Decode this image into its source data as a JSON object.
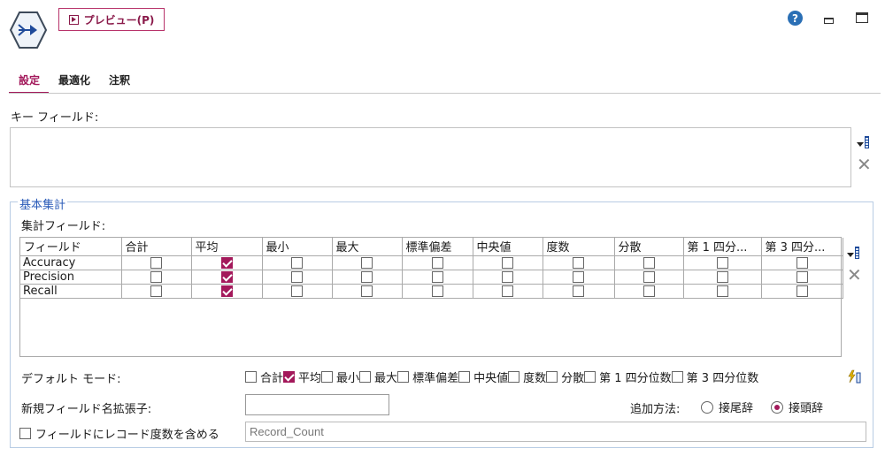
{
  "header": {
    "preview_label": "プレビュー(P)",
    "help_icon_text": "?"
  },
  "tabs": [
    {
      "label": "設定",
      "active": true
    },
    {
      "label": "最適化",
      "active": false
    },
    {
      "label": "注釈",
      "active": false
    }
  ],
  "key_fields": {
    "label": "キー フィールド:"
  },
  "basic_agg": {
    "legend": "基本集計",
    "agg_fields_label": "集計フィールド:",
    "columns": [
      "フィールド",
      "合計",
      "平均",
      "最小",
      "最大",
      "標準偏差",
      "中央値",
      "度数",
      "分散",
      "第 1 四分...",
      "第 3 四分..."
    ],
    "rows": [
      {
        "field": "Accuracy",
        "checks": [
          false,
          true,
          false,
          false,
          false,
          false,
          false,
          false,
          false,
          false
        ]
      },
      {
        "field": "Precision",
        "checks": [
          false,
          true,
          false,
          false,
          false,
          false,
          false,
          false,
          false,
          false
        ]
      },
      {
        "field": "Recall",
        "checks": [
          false,
          true,
          false,
          false,
          false,
          false,
          false,
          false,
          false,
          false
        ]
      }
    ],
    "default_mode_label": "デフォルト モード:",
    "default_modes": [
      {
        "label": "合計",
        "checked": false
      },
      {
        "label": "平均",
        "checked": true
      },
      {
        "label": "最小",
        "checked": false
      },
      {
        "label": "最大",
        "checked": false
      },
      {
        "label": "標準偏差",
        "checked": false
      },
      {
        "label": "中央値",
        "checked": false
      },
      {
        "label": "度数",
        "checked": false
      },
      {
        "label": "分散",
        "checked": false
      },
      {
        "label": "第 1 四分位数",
        "checked": false
      },
      {
        "label": "第 3 四分位数",
        "checked": false
      }
    ],
    "new_field_ext_label": "新規フィールド名拡張子:",
    "new_field_ext_value": "",
    "append_label": "追加方法:",
    "append_options": [
      {
        "label": "接尾辞",
        "selected": false
      },
      {
        "label": "接頭辞",
        "selected": true
      }
    ],
    "include_count_label": "フィールドにレコード度数を含める",
    "include_count_checked": false,
    "count_field_value": "Record_Count"
  },
  "colors": {
    "accent": "#a3195b",
    "group_legend": "#2a5bb8"
  }
}
